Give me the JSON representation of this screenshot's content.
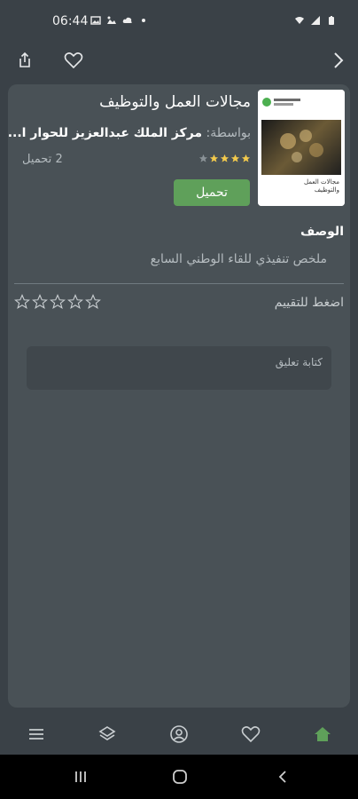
{
  "status_bar": {
    "time": "06:44",
    "left_icons": [
      "gallery-icon",
      "image-icon",
      "notification-icon",
      "cloud-icon",
      "dot-icon"
    ],
    "right_icons": [
      "wifi-icon",
      "signal-icon",
      "battery-icon"
    ]
  },
  "top_bar": {
    "share_icon": "share-icon",
    "favorite_icon": "heart-icon",
    "back_icon": "chevron-right-icon"
  },
  "book": {
    "title": "مجالات العمل والتوظيف",
    "author_prefix": "بواسطة:",
    "author_name": "مركز الملك عبدالعزيز للحوار ا...",
    "rating": 4,
    "rating_max": 5,
    "downloads": "2 تحميل",
    "download_label": "تحميل",
    "cover_title": "مجالات العمل\nوالتوظيف"
  },
  "description": {
    "heading": "الوصف",
    "text": "ملخص تنفيذي للقاء الوطني السابع"
  },
  "rating_input": {
    "label": "اضغط للتقييم",
    "stars": 5
  },
  "comment": {
    "placeholder": "كتابة تعليق"
  },
  "tab_bar": {
    "items": [
      "menu-icon",
      "layers-icon",
      "profile-icon",
      "heart-icon",
      "home-icon"
    ],
    "active": "home-icon"
  },
  "colors": {
    "background": "#3a4147",
    "card": "#495156",
    "accent_green": "#5fa05a",
    "star_gold": "#f2c94c"
  }
}
